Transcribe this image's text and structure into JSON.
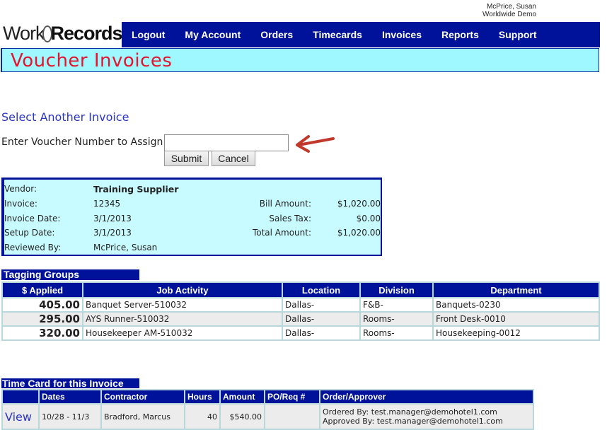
{
  "user": {
    "name": "McPrice, Susan",
    "org": "Worldwide Demo"
  },
  "logo": {
    "part1": "Work",
    "part2": "Records"
  },
  "nav": [
    "Logout",
    "My Account",
    "Orders",
    "Timecards",
    "Invoices",
    "Reports",
    "Support"
  ],
  "page_title": "Voucher Invoices",
  "select_section": {
    "heading": "Select Another Invoice",
    "label": "Enter Voucher Number to Assign:",
    "input_value": "",
    "submit": "Submit",
    "cancel": "Cancel"
  },
  "invoice": {
    "vendor_label": "Vendor:",
    "vendor": "Training Supplier",
    "invoice_label": "Invoice:",
    "invoice": "12345",
    "invoice_date_label": "Invoice Date:",
    "invoice_date": "3/1/2013",
    "setup_date_label": "Setup Date:",
    "setup_date": "3/1/2013",
    "reviewed_label": "Reviewed By:",
    "reviewed": "McPrice, Susan",
    "bill_amount_label": "Bill Amount:",
    "bill_amount": "$1,020.00",
    "sales_tax_label": "Sales Tax:",
    "sales_tax": "$0.00",
    "total_label": "Total Amount:",
    "total": "$1,020.00"
  },
  "tagging": {
    "heading": "Tagging Groups",
    "columns": [
      "$ Applied",
      "Job Activity",
      "Location",
      "Division",
      "Department"
    ],
    "rows": [
      [
        "405.00",
        "Banquet Server-510032",
        "Dallas-",
        "F&B-",
        "Banquets-0230"
      ],
      [
        "295.00",
        "AYS Runner-510032",
        "Dallas-",
        "Rooms-",
        "Front Desk-0010"
      ],
      [
        "320.00",
        "Housekeeper AM-510032",
        "Dallas-",
        "Rooms-",
        "Housekeeping-0012"
      ]
    ]
  },
  "timecard": {
    "heading": "Time Card for this Invoice",
    "columns": [
      "",
      "Dates",
      "Contractor",
      "Hours",
      "Amount",
      "PO/Req #",
      "Order/Approver"
    ],
    "rows": [
      {
        "view": "View",
        "dates": "10/28 - 11/3",
        "contractor": "Bradford, Marcus",
        "hours": "40",
        "amount": "$540.00",
        "po": "",
        "ordered": "Ordered By: test.manager@demohotel1.com",
        "approved": "Approved By: test.manager@demohotel1.com"
      }
    ]
  },
  "colors": {
    "nav_bg": "#00119a",
    "title_bg": "#9ff7ff",
    "title_text": "#e3162e",
    "arrow": "#c0392b"
  }
}
